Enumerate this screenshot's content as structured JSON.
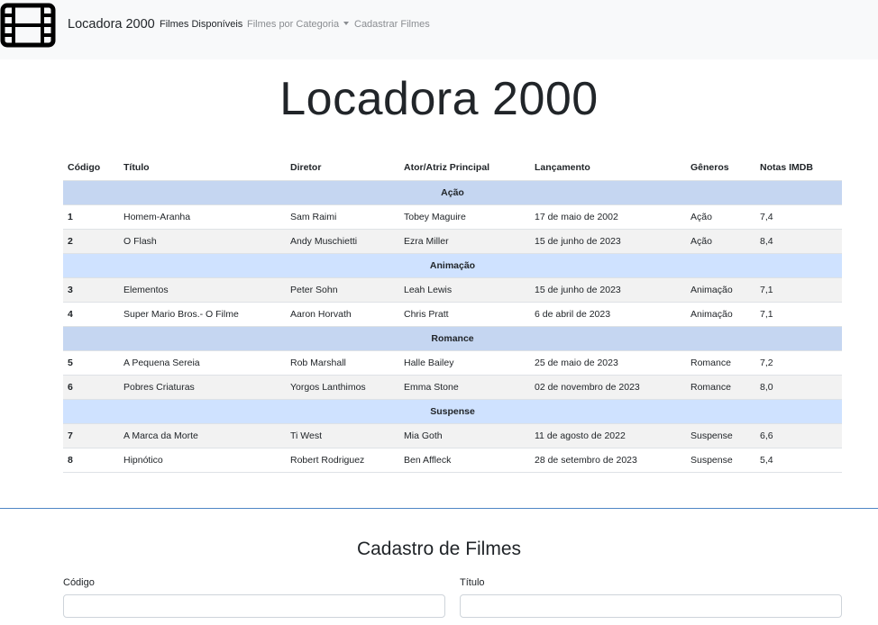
{
  "navbar": {
    "brand": "Locadora 2000",
    "links": [
      {
        "label": "Filmes Disponíveis"
      },
      {
        "label": "Filmes por Categoria"
      },
      {
        "label": "Cadastrar Filmes"
      }
    ],
    "logo_icon": "film-icon"
  },
  "page": {
    "title": "Locadora 2000"
  },
  "table": {
    "headers": [
      "Código",
      "Título",
      "Diretor",
      "Ator/Atriz Principal",
      "Lançamento",
      "Gêneros",
      "Notas IMDB"
    ],
    "groups": [
      {
        "name": "Ação",
        "rows": [
          [
            "1",
            "Homem-Aranha",
            "Sam Raimi",
            "Tobey Maguire",
            "17 de maio de 2002",
            "Ação",
            "7,4"
          ],
          [
            "2",
            "O Flash",
            "Andy Muschietti",
            "Ezra Miller",
            "15 de junho de 2023",
            "Ação",
            "8,4"
          ]
        ]
      },
      {
        "name": "Animação",
        "rows": [
          [
            "3",
            "Elementos",
            "Peter Sohn",
            "Leah Lewis",
            "15 de junho de 2023",
            "Animação",
            "7,1"
          ],
          [
            "4",
            "Super Mario Bros.- O Filme",
            "Aaron Horvath",
            "Chris Pratt",
            "6 de abril de 2023",
            "Animação",
            "7,1"
          ]
        ]
      },
      {
        "name": "Romance",
        "rows": [
          [
            "5",
            "A Pequena Sereia",
            "Rob Marshall",
            "Halle Bailey",
            "25 de maio de 2023",
            "Romance",
            "7,2"
          ],
          [
            "6",
            "Pobres Criaturas",
            "Yorgos Lanthimos",
            "Emma Stone",
            "02 de novembro de 2023",
            "Romance",
            "8,0"
          ]
        ]
      },
      {
        "name": "Suspense",
        "rows": [
          [
            "7",
            "A Marca da Morte",
            "Ti West",
            "Mia Goth",
            "11 de agosto de 2022",
            "Suspense",
            "6,6"
          ],
          [
            "8",
            "Hipnótico",
            "Robert Rodriguez",
            "Ben Affleck",
            "28 de setembro de 2023",
            "Suspense",
            "5,4"
          ]
        ]
      }
    ]
  },
  "form": {
    "title": "Cadastro de Filmes",
    "fields": [
      {
        "label": "Código",
        "value": ""
      },
      {
        "label": "Título",
        "value": ""
      }
    ]
  }
}
